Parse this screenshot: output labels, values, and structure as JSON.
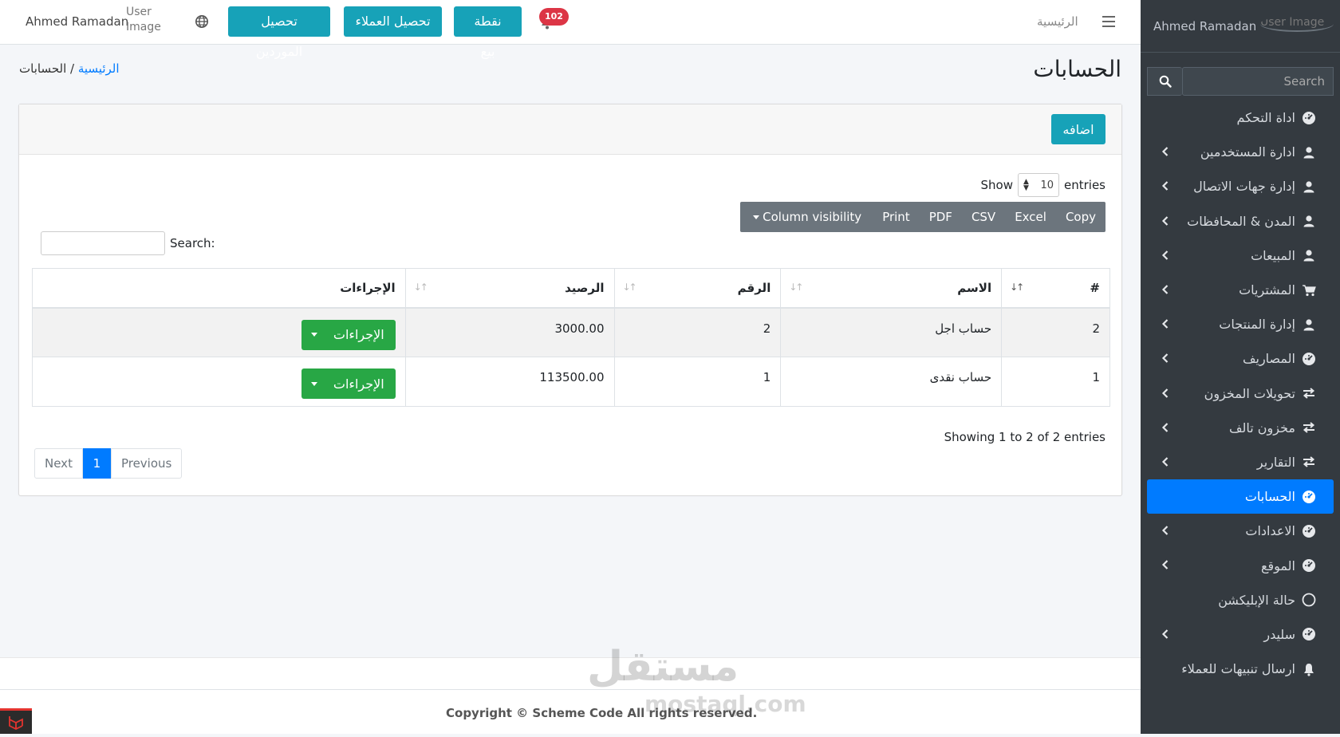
{
  "topbar": {
    "user_name": "Ahmed Ramadan",
    "user_image_alt": "User Image",
    "buttons": {
      "suppliers": "تحصيل الموردين",
      "customers": "تحصيل العملاء",
      "pos": "نقطة بيع"
    },
    "notification_count": "102",
    "home_link": "الرئيسية"
  },
  "page": {
    "title": "الحسابات",
    "breadcrumb": {
      "home": "الرئيسية",
      "separator": " / ",
      "current": "الحسابات"
    }
  },
  "card": {
    "add_button": "اضافه",
    "length": {
      "show": "Show",
      "value": "10",
      "entries": "entries"
    },
    "export_buttons": [
      "Copy",
      "Excel",
      "CSV",
      "PDF",
      "Print",
      "Column visibility"
    ],
    "search_label": "Search:",
    "table": {
      "headers": [
        "#",
        "الاسم",
        "الرقم",
        "الرصيد",
        "الإجراءات"
      ],
      "rows": [
        {
          "id": "2",
          "name": "حساب اجل",
          "number": "2",
          "balance": "3000.00",
          "action": "الإجراءات"
        },
        {
          "id": "1",
          "name": "حساب نقدى",
          "number": "1",
          "balance": "113500.00",
          "action": "الإجراءات"
        }
      ]
    },
    "info": "Showing 1 to 2 of 2 entries",
    "pagination": {
      "previous": "Previous",
      "current": "1",
      "next": "Next"
    }
  },
  "footer": {
    "copyright": "Copyright © Scheme Code All rights reserved.",
    "watermark_logo": "مستقل",
    "watermark_domain": "mostaql.com"
  },
  "sidebar": {
    "user_name": "Ahmed Ramadan",
    "user_image_alt": "User Image",
    "search_placeholder": "Search",
    "items": [
      {
        "label": "اداة التحكم",
        "icon": "dashboard-icon",
        "chevron": false,
        "active": false
      },
      {
        "label": "ادارة المستخدمين",
        "icon": "user-icon",
        "chevron": true,
        "active": false
      },
      {
        "label": "إدارة جهات الاتصال",
        "icon": "user-icon",
        "chevron": true,
        "active": false
      },
      {
        "label": "المدن & المحافظات",
        "icon": "user-icon",
        "chevron": true,
        "active": false
      },
      {
        "label": "المبيعات",
        "icon": "user-icon",
        "chevron": true,
        "active": false
      },
      {
        "label": "المشتريات",
        "icon": "cart-icon",
        "chevron": true,
        "active": false
      },
      {
        "label": "إدارة المنتجات",
        "icon": "user-icon",
        "chevron": true,
        "active": false
      },
      {
        "label": "المصاريف",
        "icon": "dashboard-icon",
        "chevron": true,
        "active": false
      },
      {
        "label": "تحويلات المخزون",
        "icon": "exchange-icon",
        "chevron": true,
        "active": false
      },
      {
        "label": "مخزون تالف",
        "icon": "exchange-icon",
        "chevron": true,
        "active": false
      },
      {
        "label": "التقارير",
        "icon": "exchange-icon",
        "chevron": true,
        "active": false
      },
      {
        "label": "الحسابات",
        "icon": "dashboard-icon",
        "chevron": false,
        "active": true
      },
      {
        "label": "الاعدادات",
        "icon": "dashboard-icon",
        "chevron": true,
        "active": false
      },
      {
        "label": "الموقع",
        "icon": "dashboard-icon",
        "chevron": true,
        "active": false
      },
      {
        "label": "حالة الإبليكشن",
        "icon": "circle-icon",
        "chevron": false,
        "active": false
      },
      {
        "label": "سليدر",
        "icon": "dashboard-icon",
        "chevron": true,
        "active": false
      },
      {
        "label": "ارسال تنبيهات للعملاء",
        "icon": "bell-icon",
        "chevron": false,
        "active": false
      }
    ]
  },
  "colors": {
    "sidebar_bg": "#343a40",
    "primary": "#007bff",
    "teal": "#17a2b8",
    "success": "#28a745",
    "danger": "#dc3545",
    "export_bg": "#6c757d"
  }
}
